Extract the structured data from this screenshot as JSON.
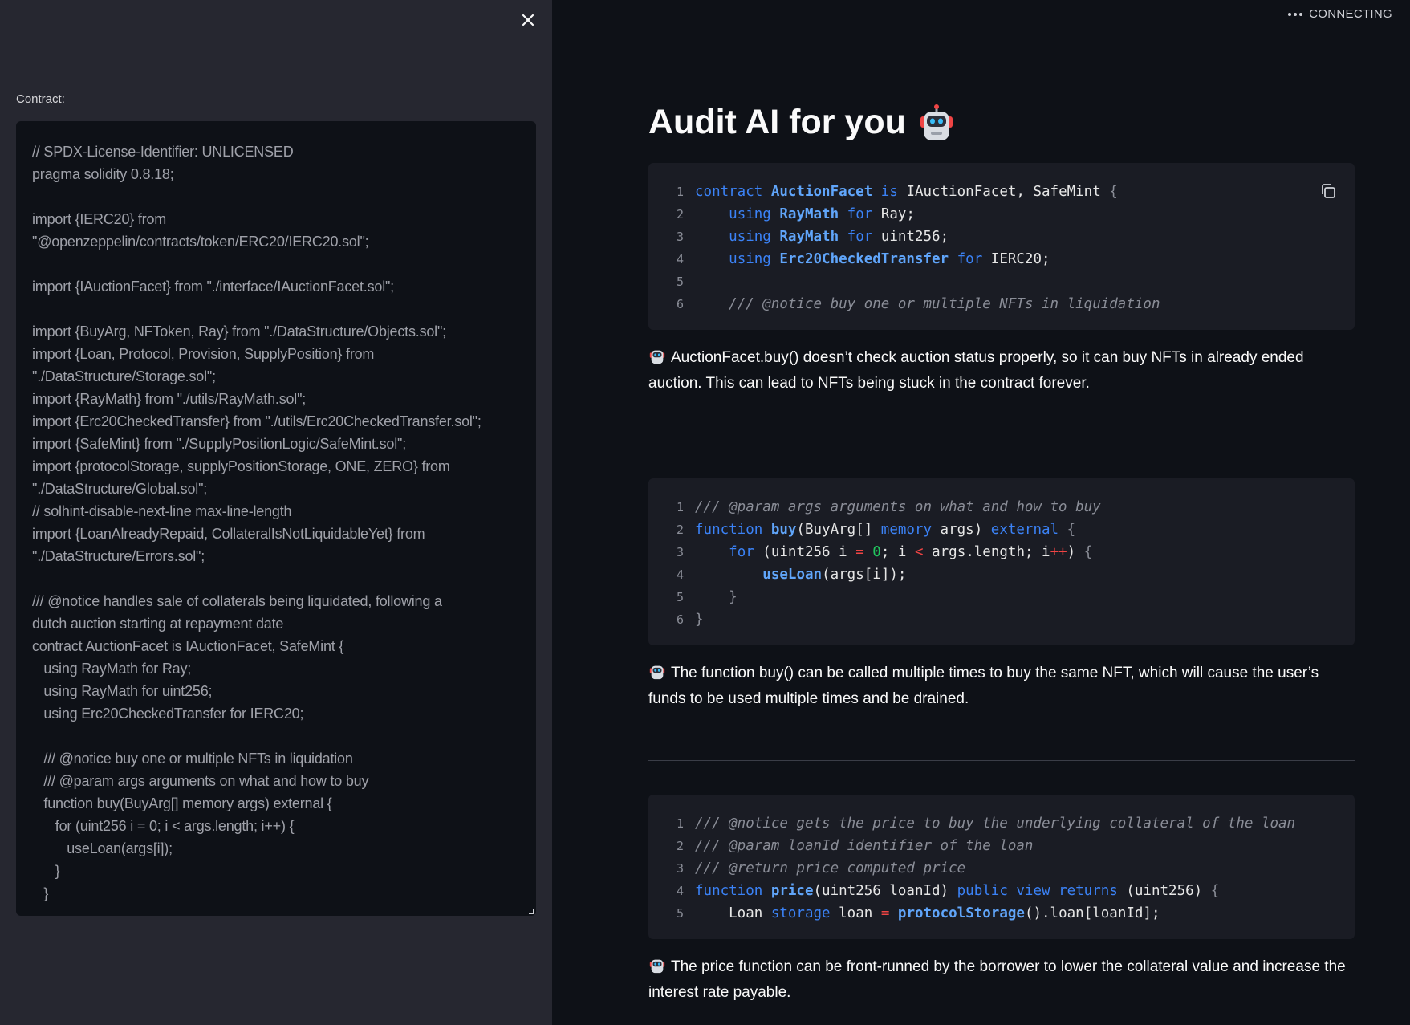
{
  "sidebar": {
    "contract_label": "Contract:",
    "contract_source": "// SPDX-License-Identifier: UNLICENSED\npragma solidity 0.8.18;\n\nimport {IERC20} from\n\"@openzeppelin/contracts/token/ERC20/IERC20.sol\";\n\nimport {IAuctionFacet} from \"./interface/IAuctionFacet.sol\";\n\nimport {BuyArg, NFToken, Ray} from \"./DataStructure/Objects.sol\";\nimport {Loan, Protocol, Provision, SupplyPosition} from\n\"./DataStructure/Storage.sol\";\nimport {RayMath} from \"./utils/RayMath.sol\";\nimport {Erc20CheckedTransfer} from \"./utils/Erc20CheckedTransfer.sol\";\nimport {SafeMint} from \"./SupplyPositionLogic/SafeMint.sol\";\nimport {protocolStorage, supplyPositionStorage, ONE, ZERO} from\n\"./DataStructure/Global.sol\";\n// solhint-disable-next-line max-line-length\nimport {LoanAlreadyRepaid, CollateralIsNotLiquidableYet} from\n\"./DataStructure/Errors.sol\";\n\n/// @notice handles sale of collaterals being liquidated, following a\ndutch auction starting at repayment date\ncontract AuctionFacet is IAuctionFacet, SafeMint {\n   using RayMath for Ray;\n   using RayMath for uint256;\n   using Erc20CheckedTransfer for IERC20;\n\n   /// @notice buy one or multiple NFTs in liquidation\n   /// @param args arguments on what and how to buy\n   function buy(BuyArg[] memory args) external {\n      for (uint256 i = 0; i < args.length; i++) {\n         useLoan(args[i]);\n      }\n   }"
  },
  "status": {
    "label": "CONNECTING"
  },
  "main": {
    "title": "Audit AI for you",
    "findings": [
      {
        "code": [
          {
            "n": "1",
            "segs": [
              [
                "kw",
                "contract "
              ],
              [
                "ty",
                "AuctionFacet"
              ],
              [
                "kw",
                " is "
              ],
              [
                "",
                "IAuctionFacet, SafeMint "
              ],
              [
                "pu",
                "{"
              ]
            ]
          },
          {
            "n": "2",
            "segs": [
              [
                "",
                "    "
              ],
              [
                "kw",
                "using "
              ],
              [
                "ty",
                "RayMath"
              ],
              [
                "kw",
                " for "
              ],
              [
                "",
                "Ray;"
              ]
            ]
          },
          {
            "n": "3",
            "segs": [
              [
                "",
                "    "
              ],
              [
                "kw",
                "using "
              ],
              [
                "ty",
                "RayMath"
              ],
              [
                "kw",
                " for "
              ],
              [
                "",
                "uint256;"
              ]
            ]
          },
          {
            "n": "4",
            "segs": [
              [
                "",
                "    "
              ],
              [
                "kw",
                "using "
              ],
              [
                "ty",
                "Erc20CheckedTransfer"
              ],
              [
                "kw",
                " for "
              ],
              [
                "",
                "IERC20;"
              ]
            ]
          },
          {
            "n": "5",
            "segs": []
          },
          {
            "n": "6",
            "segs": [
              [
                "",
                "    "
              ],
              [
                "cm",
                "/// @notice buy one or multiple NFTs in liquidation"
              ]
            ]
          }
        ],
        "text": "AuctionFacet.buy() doesn’t check auction status properly, so it can buy NFTs in already ended auction. This can lead to NFTs being stuck in the contract forever."
      },
      {
        "code": [
          {
            "n": "1",
            "segs": [
              [
                "cm",
                "/// @param args arguments on what and how to buy"
              ]
            ]
          },
          {
            "n": "2",
            "segs": [
              [
                "kw",
                "function "
              ],
              [
                "ty",
                "buy"
              ],
              [
                "",
                "(BuyArg[] "
              ],
              [
                "kw",
                "memory"
              ],
              [
                "",
                " args) "
              ],
              [
                "kw",
                "external"
              ],
              [
                "pu",
                " {"
              ]
            ]
          },
          {
            "n": "3",
            "segs": [
              [
                "",
                "    "
              ],
              [
                "kw",
                "for"
              ],
              [
                "",
                " (uint256 i "
              ],
              [
                "op",
                "="
              ],
              [
                "",
                " "
              ],
              [
                "nu",
                "0"
              ],
              [
                "",
                "; i "
              ],
              [
                "op",
                "<"
              ],
              [
                "",
                " args.length; i"
              ],
              [
                "op",
                "++"
              ],
              [
                "",
                ") "
              ],
              [
                "pu",
                "{"
              ]
            ]
          },
          {
            "n": "4",
            "segs": [
              [
                "",
                "        "
              ],
              [
                "ty",
                "useLoan"
              ],
              [
                "",
                "(args[i]);"
              ]
            ]
          },
          {
            "n": "5",
            "segs": [
              [
                "",
                "    "
              ],
              [
                "pu",
                "}"
              ]
            ]
          },
          {
            "n": "6",
            "segs": [
              [
                "pu",
                "}"
              ]
            ]
          }
        ],
        "text": "The function buy() can be called multiple times to buy the same NFT, which will cause the user’s funds to be used multiple times and be drained."
      },
      {
        "code": [
          {
            "n": "1",
            "segs": [
              [
                "cm",
                "/// @notice gets the price to buy the underlying collateral of the loan"
              ]
            ]
          },
          {
            "n": "2",
            "segs": [
              [
                "cm",
                "/// @param loanId identifier of the loan"
              ]
            ]
          },
          {
            "n": "3",
            "segs": [
              [
                "cm",
                "/// @return price computed price"
              ]
            ]
          },
          {
            "n": "4",
            "segs": [
              [
                "kw",
                "function "
              ],
              [
                "ty",
                "price"
              ],
              [
                "",
                "(uint256 loanId) "
              ],
              [
                "kw",
                "public view returns"
              ],
              [
                "",
                " (uint256) "
              ],
              [
                "pu",
                "{"
              ]
            ]
          },
          {
            "n": "5",
            "segs": [
              [
                "",
                "    Loan "
              ],
              [
                "kw",
                "storage"
              ],
              [
                "",
                " loan "
              ],
              [
                "op",
                "="
              ],
              [
                "",
                " "
              ],
              [
                "ty",
                "protocolStorage"
              ],
              [
                "",
                "().loan[loanId];"
              ]
            ]
          }
        ],
        "text": "The price function can be front-runned by the borrower to lower the collateral value and increase the interest rate payable."
      }
    ]
  }
}
